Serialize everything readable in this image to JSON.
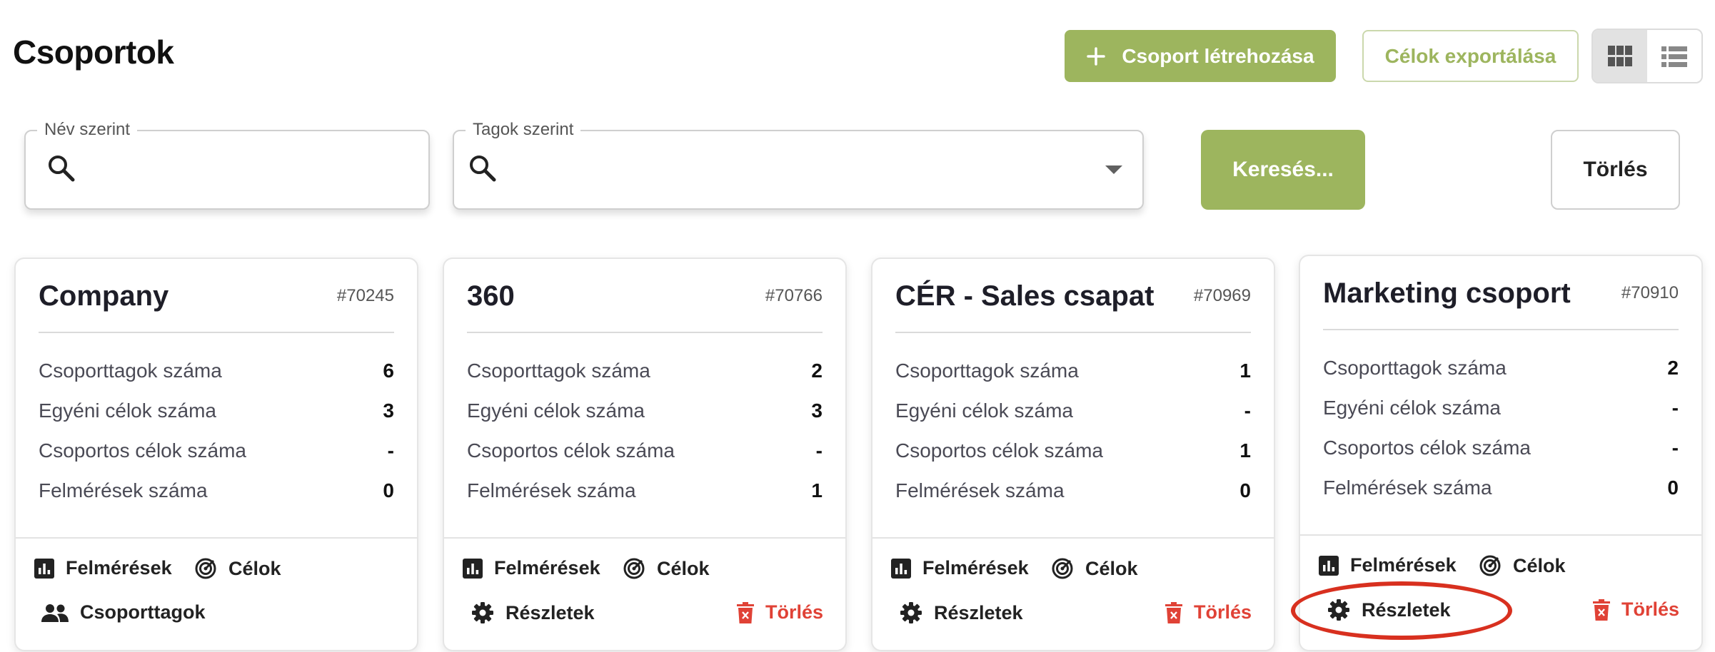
{
  "page": {
    "title": "Csoportok"
  },
  "header": {
    "create_button": "Csoport létrehozása",
    "export_button": "Célok exportálása",
    "view_modes": [
      "grid-view-icon",
      "list-view-icon"
    ],
    "active_view": "grid"
  },
  "filters": {
    "name": {
      "label": "Név szerint",
      "value": ""
    },
    "members": {
      "label": "Tagok szerint",
      "value": ""
    },
    "search_button": "Keresés...",
    "clear_button": "Törlés"
  },
  "labels": {
    "members_count": "Csoporttagok száma",
    "individual_goals": "Egyéni célok száma",
    "group_goals": "Csoportos célok száma",
    "surveys": "Felmérések száma",
    "surveys_action": "Felmérések",
    "goals_action": "Célok",
    "members_action": "Csoporttagok",
    "details_action": "Részletek",
    "delete_action": "Törlés"
  },
  "cards": [
    {
      "title": "Company",
      "id": "#70245",
      "members": "6",
      "individual_goals": "3",
      "group_goals": "-",
      "surveys": "0"
    },
    {
      "title": "360",
      "id": "#70766",
      "members": "2",
      "individual_goals": "3",
      "group_goals": "-",
      "surveys": "1"
    },
    {
      "title": "CÉR - Sales csapat",
      "id": "#70969",
      "members": "1",
      "individual_goals": "-",
      "group_goals": "1",
      "surveys": "0"
    },
    {
      "title": "Marketing csoport",
      "id": "#70910",
      "members": "2",
      "individual_goals": "-",
      "group_goals": "-",
      "surveys": "0"
    }
  ],
  "colors": {
    "accent": "#9db55e",
    "danger": "#e04236",
    "highlight": "#d8301f"
  }
}
